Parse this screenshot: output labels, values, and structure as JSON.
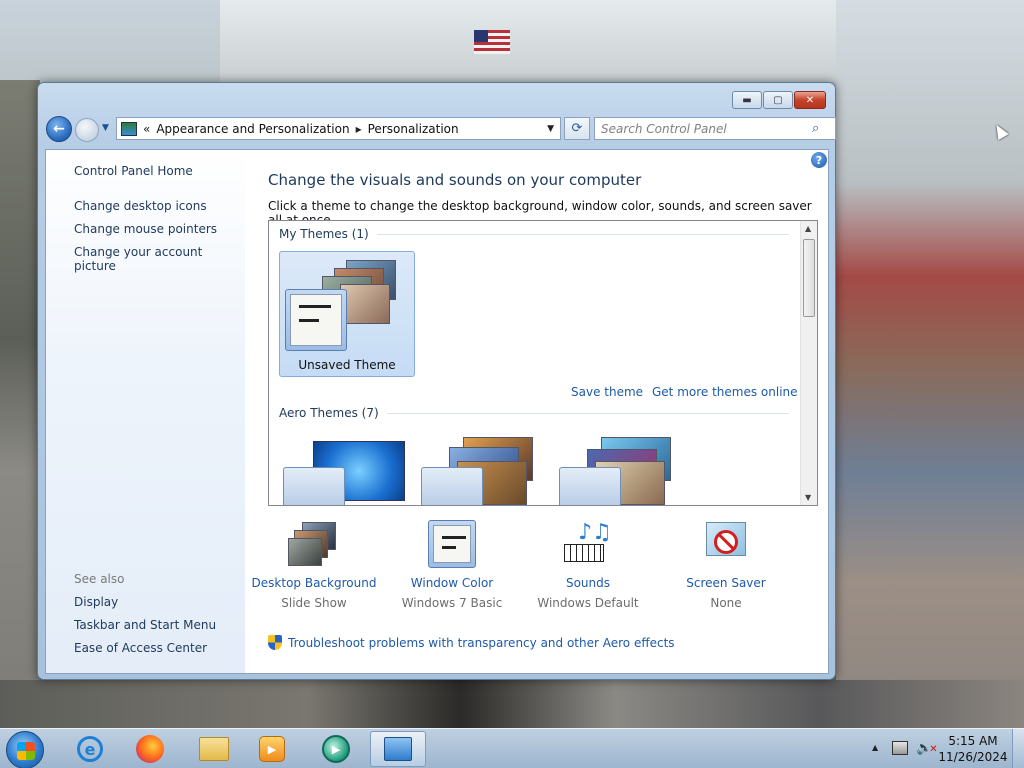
{
  "window": {
    "breadcrumb": [
      "Appearance and Personalization",
      "Personalization"
    ],
    "breadcrumb_prefix": "«",
    "search_placeholder": "Search Control Panel"
  },
  "left_pane": {
    "home": "Control Panel Home",
    "tasks": [
      "Change desktop icons",
      "Change mouse pointers",
      "Change your account picture"
    ],
    "see_also_title": "See also",
    "see_also": [
      "Display",
      "Taskbar and Start Menu",
      "Ease of Access Center"
    ]
  },
  "main": {
    "title": "Change the visuals and sounds on your computer",
    "subtitle": "Click a theme to change the desktop background, window color, sounds, and screen saver all at once.",
    "my_themes_header": "My Themes (1)",
    "unsaved_theme": "Unsaved Theme",
    "save_theme": "Save theme",
    "get_more": "Get more themes online",
    "aero_header": "Aero Themes (7)",
    "items": [
      {
        "label": "Desktop Background",
        "value": "Slide Show"
      },
      {
        "label": "Window Color",
        "value": "Windows 7 Basic"
      },
      {
        "label": "Sounds",
        "value": "Windows Default"
      },
      {
        "label": "Screen Saver",
        "value": "None"
      }
    ],
    "troubleshoot": "Troubleshoot problems with transparency and other Aero effects"
  },
  "taskbar": {
    "time": "5:15 AM",
    "date": "11/26/2024"
  },
  "colors": {
    "link": "#1e5aa8",
    "heading": "#1e395b",
    "taskbar": "#a0bad4"
  }
}
